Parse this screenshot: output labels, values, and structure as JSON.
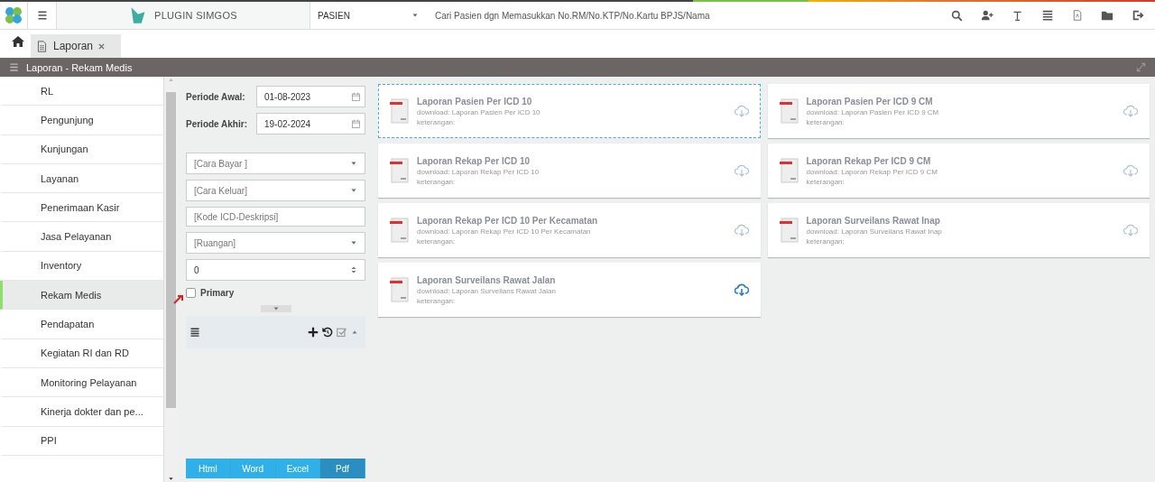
{
  "topbar": {
    "brand": "PLUGIN SIMGOS",
    "search_category": "PASIEN",
    "search": {
      "placeholder": "Cari Pasien dgn Memasukkan No.RM/No.KTP/No.Kartu BPJS/Nama"
    }
  },
  "tabs": [
    {
      "label": "Laporan",
      "selected": true
    }
  ],
  "panel": {
    "title": "Laporan - Rekam Medis"
  },
  "sidebar": {
    "items": [
      {
        "label": "RL",
        "selected": false
      },
      {
        "label": "Pengunjung",
        "selected": false
      },
      {
        "label": "Kunjungan",
        "selected": false
      },
      {
        "label": "Layanan",
        "selected": false
      },
      {
        "label": "Penerimaan Kasir",
        "selected": false
      },
      {
        "label": "Jasa Pelayanan",
        "selected": false
      },
      {
        "label": "Inventory",
        "selected": false
      },
      {
        "label": "Rekam Medis",
        "selected": true
      },
      {
        "label": "Pendapatan",
        "selected": false
      },
      {
        "label": "Kegiatan RI dan RD",
        "selected": false
      },
      {
        "label": "Monitoring Pelayanan",
        "selected": false
      },
      {
        "label": "Kinerja dokter dan pe...",
        "selected": false
      },
      {
        "label": "PPI",
        "selected": false
      }
    ]
  },
  "filters": {
    "dates": [
      {
        "label": "Periode Awal:",
        "value": "01-08-2023"
      },
      {
        "label": "Periode Akhir:",
        "value": "19-02-2024"
      }
    ],
    "fields": [
      {
        "kind": "select",
        "placeholder": "[Cara Bayar ]"
      },
      {
        "kind": "select",
        "placeholder": "[Cara Keluar]"
      },
      {
        "kind": "text",
        "placeholder": "[Kode ICD-Deskripsi]"
      },
      {
        "kind": "select",
        "placeholder": "[Ruangan]"
      },
      {
        "kind": "number",
        "value": "0"
      }
    ],
    "primary": {
      "label": "Primary",
      "checked": false
    }
  },
  "export_buttons": [
    {
      "label": "Html",
      "selected": false
    },
    {
      "label": "Word",
      "selected": false
    },
    {
      "label": "Excel",
      "selected": false
    },
    {
      "label": "Pdf",
      "selected": true
    }
  ],
  "reports": [
    {
      "title": "Laporan Pasien Per ICD 10",
      "download": "download: Laporan Pasien Per ICD 10",
      "note": "keterangan:",
      "focused": true,
      "hovered": false
    },
    {
      "title": "Laporan Pasien Per ICD 9 CM",
      "download": "download: Laporan Pasien Per ICD 9 CM",
      "note": "keterangan:",
      "focused": false,
      "hovered": false
    },
    {
      "title": "Laporan Rekap Per ICD 10",
      "download": "download: Laporan Rekap Per ICD 10",
      "note": "keterangan:",
      "focused": false,
      "hovered": false
    },
    {
      "title": "Laporan Rekap Per ICD 9 CM",
      "download": "download: Laporan Rekap Per ICD 9 CM",
      "note": "keterangan:",
      "focused": false,
      "hovered": false
    },
    {
      "title": "Laporan Rekap Per ICD 10 Per Kecamatan",
      "download": "download: Laporan Rekap Per ICD 10 Per Kecamatan",
      "note": "keterangan:",
      "focused": false,
      "hovered": false
    },
    {
      "title": "Laporan Surveilans Rawat Inap",
      "download": "download: Laporan Surveilans Rawat Inap",
      "note": "keterangan:",
      "focused": false,
      "hovered": false
    },
    {
      "title": "Laporan Surveilans Rawat Jalan",
      "download": "download: Laporan Surveilans Rawat Jalan",
      "note": "keterangan:",
      "focused": false,
      "hovered": true
    }
  ]
}
